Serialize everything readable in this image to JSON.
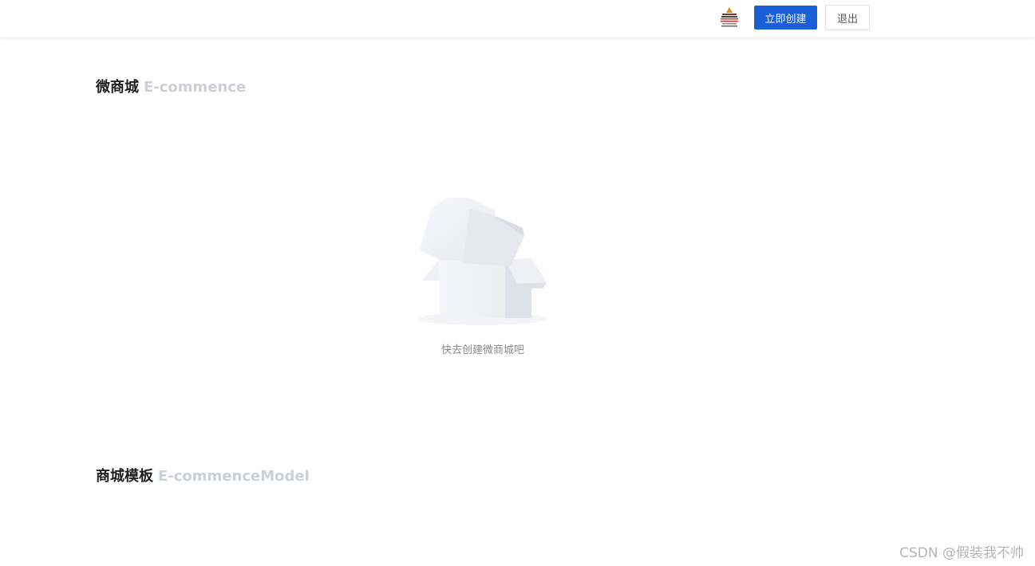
{
  "header": {
    "create_label": "立即创建",
    "logout_label": "退出"
  },
  "shop_section": {
    "title": "微商城",
    "subtitle": "E-commence"
  },
  "empty_state": {
    "text": "快去创建微商城吧"
  },
  "template_section": {
    "title": "商城模板",
    "subtitle": "E-commenceModel"
  },
  "watermark": {
    "text": "CSDN @假装我不帅"
  }
}
